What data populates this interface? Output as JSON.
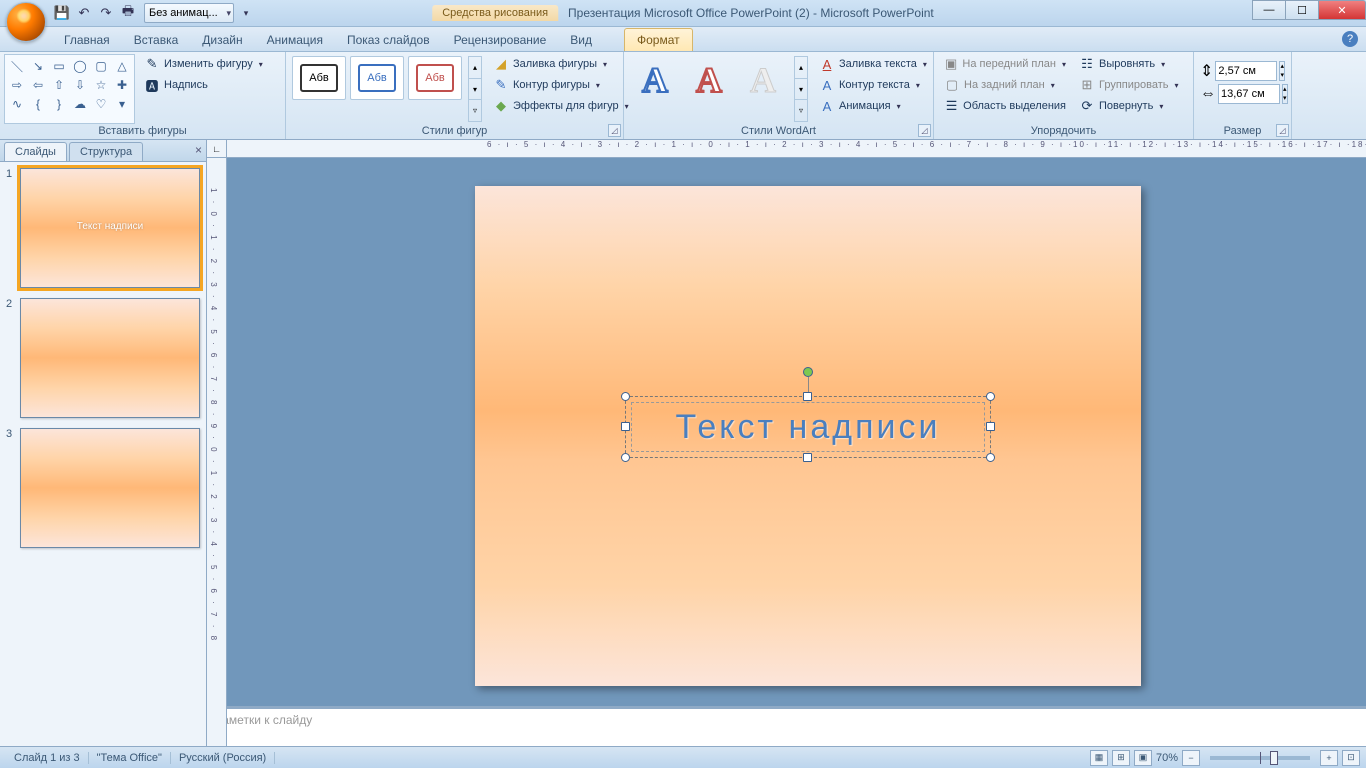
{
  "titlebar": {
    "qat_animation": "Без анимац...",
    "contextual_title": "Средства рисования",
    "window_title": "Презентация Microsoft Office PowerPoint (2) - Microsoft PowerPoint"
  },
  "tabs": {
    "home": "Главная",
    "insert": "Вставка",
    "design": "Дизайн",
    "animation": "Анимация",
    "slideshow": "Показ слайдов",
    "review": "Рецензирование",
    "view": "Вид",
    "format": "Формат"
  },
  "ribbon": {
    "insert_shapes": {
      "edit_shape": "Изменить фигуру",
      "textbox": "Надпись",
      "label": "Вставить фигуры"
    },
    "shape_styles": {
      "thumb_text": "Абв",
      "fill": "Заливка фигуры",
      "outline": "Контур фигуры",
      "effects": "Эффекты для фигур",
      "label": "Стили фигур"
    },
    "wordart": {
      "letter": "А",
      "text_fill": "Заливка текста",
      "text_outline": "Контур текста",
      "animation": "Анимация",
      "label": "Стили WordArt"
    },
    "arrange": {
      "bring_front": "На передний план",
      "send_back": "На задний план",
      "selection_pane": "Область выделения",
      "align": "Выровнять",
      "group": "Группировать",
      "rotate": "Повернуть",
      "label": "Упорядочить"
    },
    "size": {
      "height": "2,57 см",
      "width": "13,67 см",
      "label": "Размер"
    }
  },
  "left_pane": {
    "tab_slides": "Слайды",
    "tab_outline": "Структура",
    "slides": [
      {
        "num": "1",
        "text": "Текст надписи",
        "selected": true
      },
      {
        "num": "2",
        "text": "",
        "selected": false
      },
      {
        "num": "3",
        "text": "",
        "selected": false
      }
    ]
  },
  "ruler": {
    "h": "6 · ı · 5 · ı · 4 · ı · 3 · ı · 2 · ı · 1 · ı · 0 · ı · 1 · ı · 2 · ı · 3 · ı · 4 · ı · 5 · ı · 6 · ı · 7 · ı · 8 · ı · 9 · ı ·10· ı ·11· ı ·12· ı ·13· ı ·14· ı ·15· ı ·16· ı ·17· ı ·18· ı ·19",
    "v": "1 · 0 · 1 · 2 · 3 · 4 · 5 · 6 · 7 · 8 · 9 · 0 · 1 · 2 · 3 · 4 · 5 · 6 · 7 · 8"
  },
  "slide": {
    "textbox_text": "Текст надписи"
  },
  "notes": {
    "placeholder": "Заметки к слайду"
  },
  "statusbar": {
    "slide_counter": "Слайд 1 из 3",
    "theme": "\"Тема Office\"",
    "language": "Русский (Россия)",
    "zoom": "70%"
  }
}
